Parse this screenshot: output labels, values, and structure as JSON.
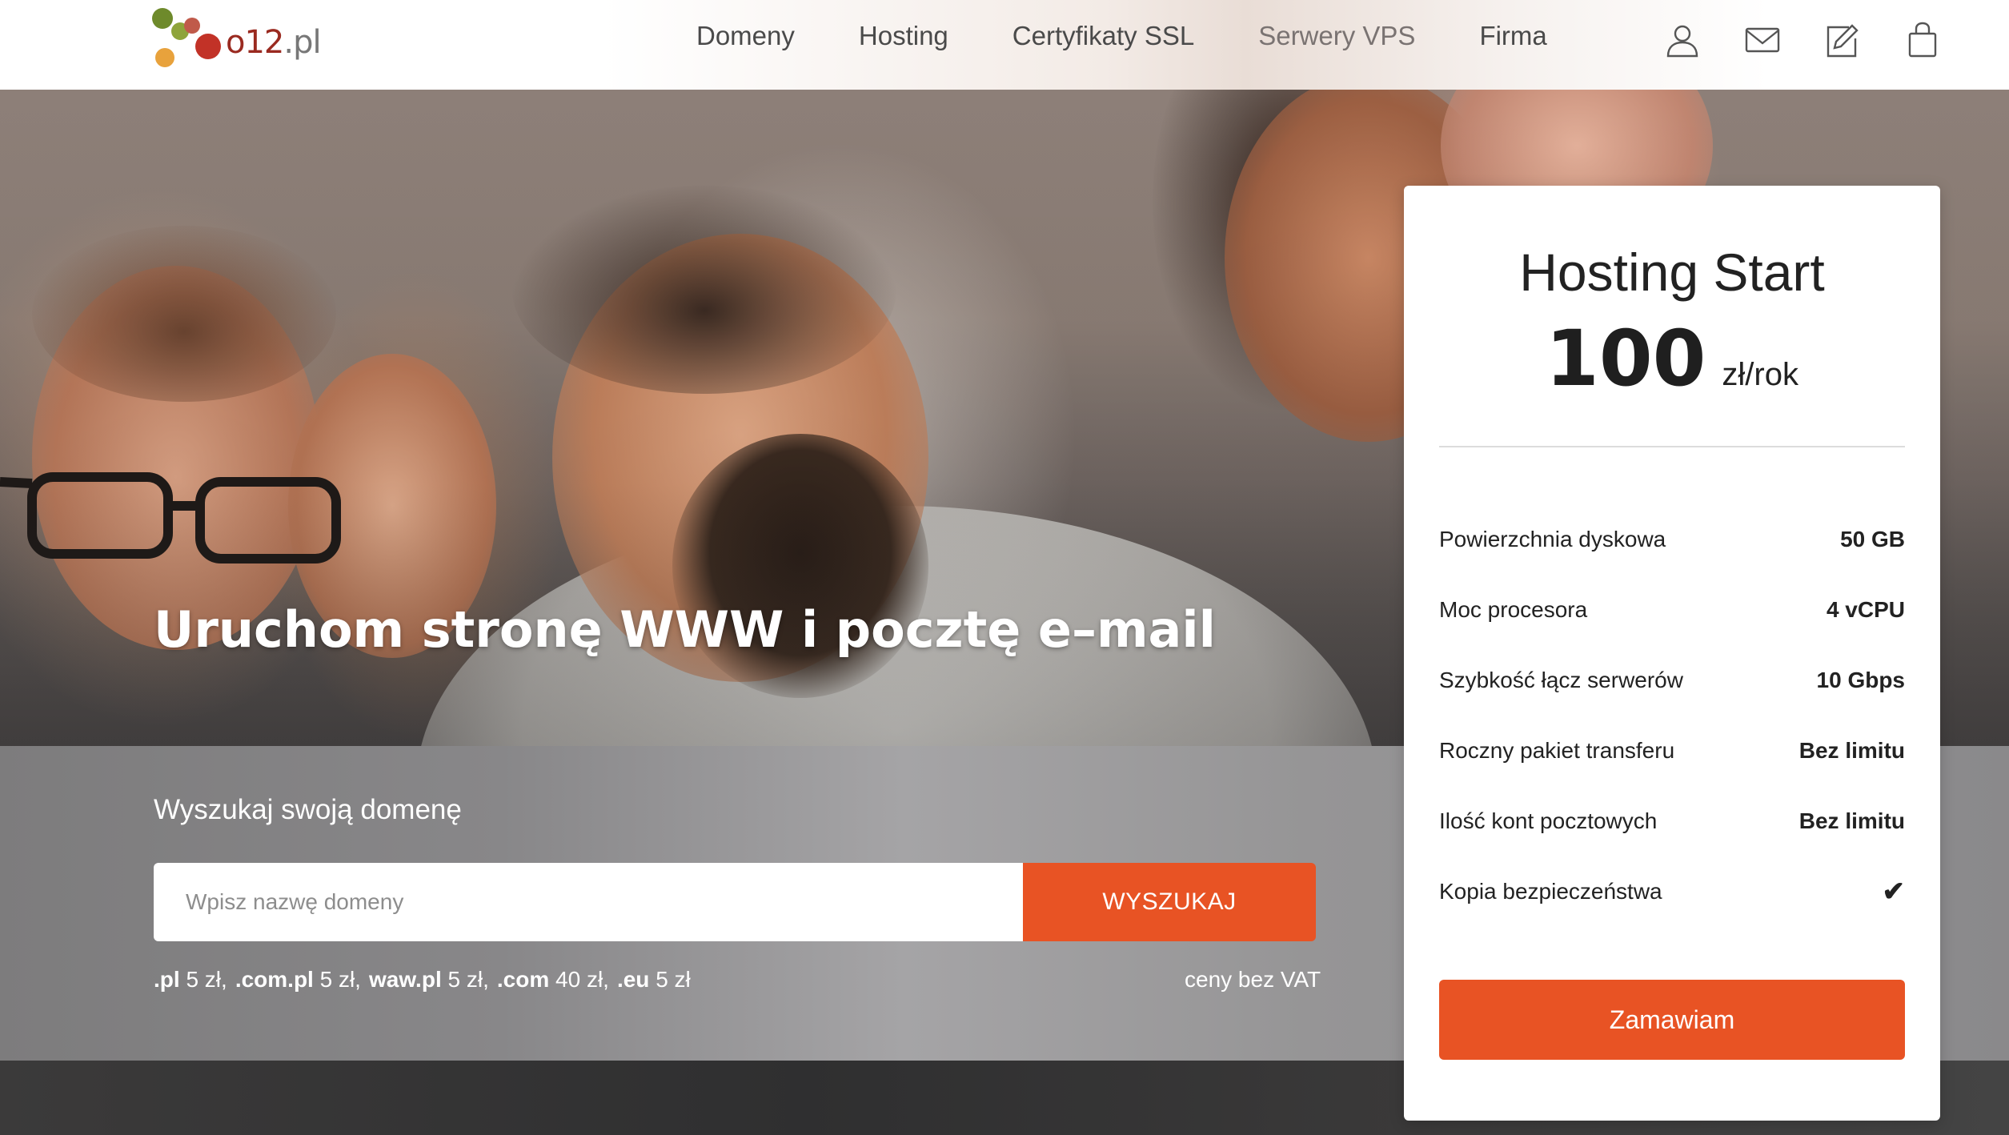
{
  "header": {
    "logo_text": "o12",
    "logo_suffix": ".pl",
    "nav": [
      {
        "label": "Domeny"
      },
      {
        "label": "Hosting"
      },
      {
        "label": "Certyfikaty SSL"
      },
      {
        "label": "Serwery VPS"
      },
      {
        "label": "Firma"
      }
    ],
    "icons": [
      "user-icon",
      "mail-icon",
      "edit-icon",
      "cart-icon"
    ]
  },
  "hero": {
    "title": "Uruchom stronę WWW i pocztę e–mail"
  },
  "search": {
    "label": "Wyszukaj swoją domenę",
    "placeholder": "Wpisz nazwę domeny",
    "button_label": "WYSZUKAJ",
    "prices": [
      {
        "tld": ".pl",
        "price": "5 zł,"
      },
      {
        "tld": ".com.pl",
        "price": "5 zł,"
      },
      {
        "tld": "waw.pl",
        "price": "5 zł,"
      },
      {
        "tld": ".com",
        "price": "40 zł,"
      },
      {
        "tld": ".eu",
        "price": "5 zł"
      }
    ],
    "vat_note": "ceny bez VAT"
  },
  "card": {
    "title": "Hosting Start",
    "price": "100",
    "unit": "zł/rok",
    "specs": [
      {
        "label": "Powierzchnia dyskowa",
        "value": "50 GB"
      },
      {
        "label": "Moc procesora",
        "value": "4 vCPU"
      },
      {
        "label": "Szybkość łącz serwerów",
        "value": "10 Gbps"
      },
      {
        "label": "Roczny pakiet transferu",
        "value": "Bez limitu"
      },
      {
        "label": "Ilość kont pocztowych",
        "value": "Bez limitu"
      },
      {
        "label": "Kopia bezpieczeństwa",
        "value": "✔"
      }
    ],
    "order_label": "Zamawiam"
  },
  "colors": {
    "accent": "#e85324",
    "logo_red": "#c23227",
    "logo_green": "#6e8a2b",
    "logo_orange": "#e8a23c"
  }
}
